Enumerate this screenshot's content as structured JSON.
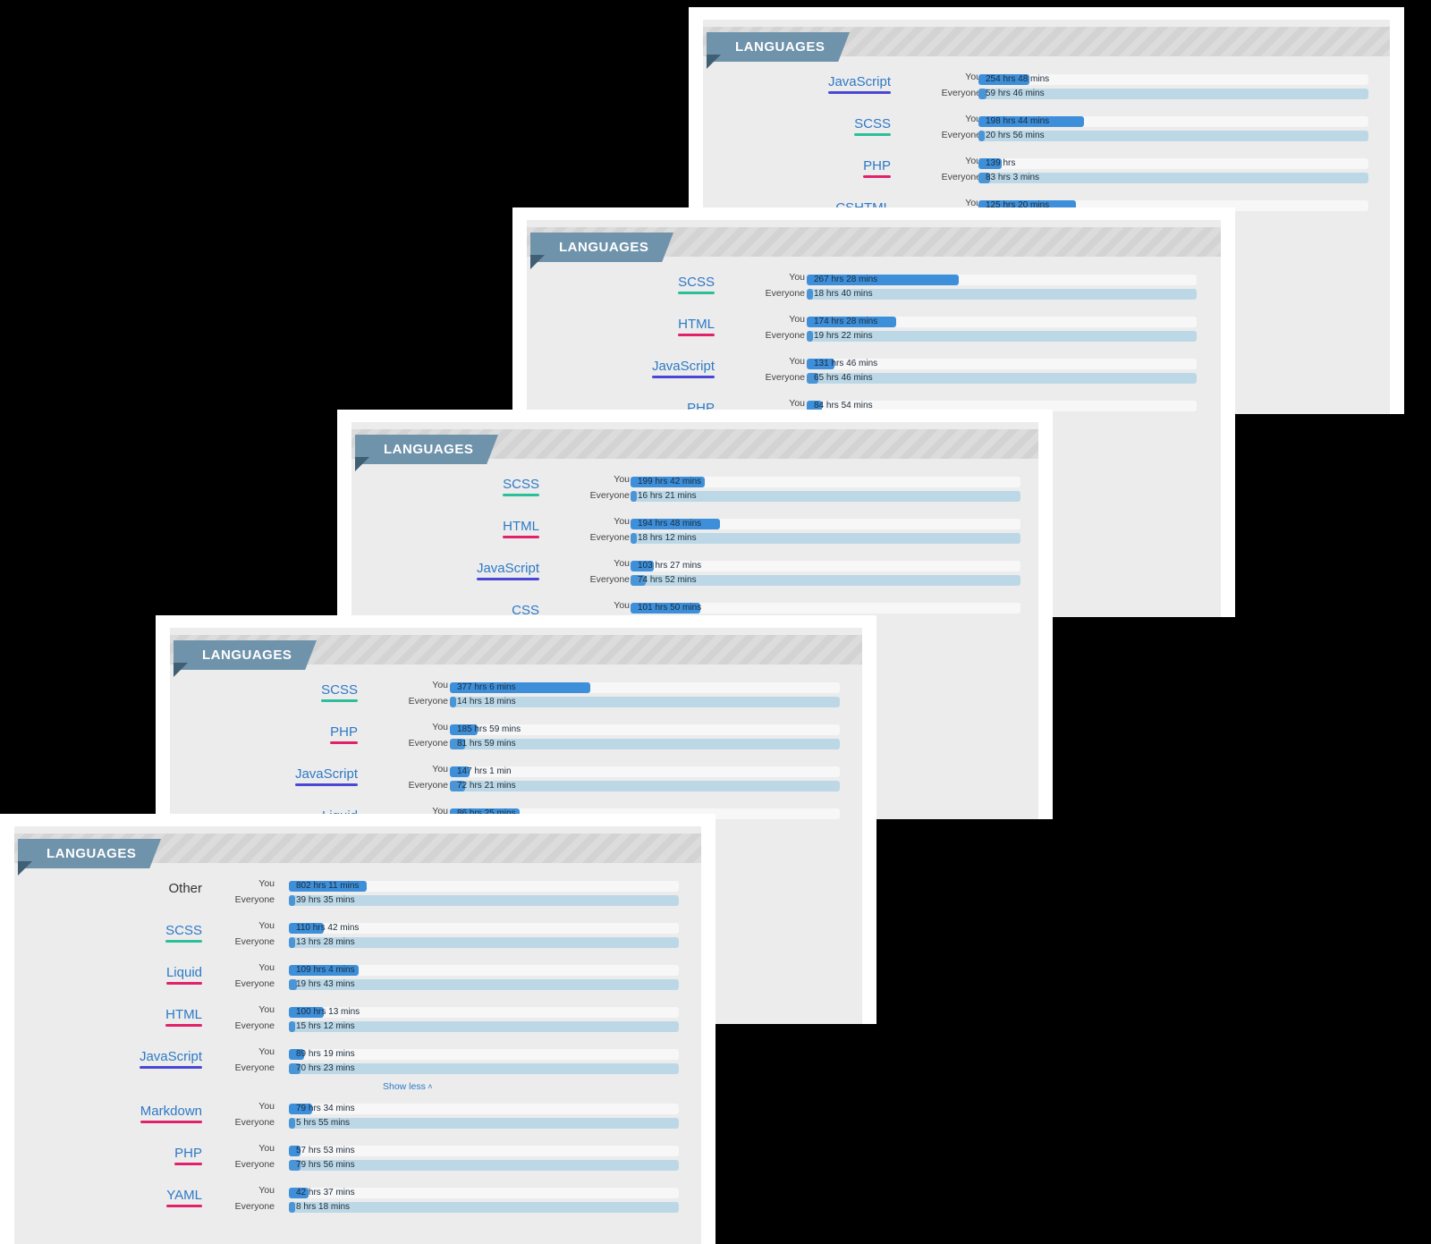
{
  "section_title": "LANGUAGES",
  "show_less": "Show less",
  "labels": {
    "you": "You",
    "everyone": "Everyone"
  },
  "colors": {
    "blue": "#2d79c7",
    "teal": "#2bbf9a",
    "pink": "#e0226b",
    "purple": "#4b47d6"
  },
  "panels": [
    {
      "rows": [
        {
          "lang": "JavaScript",
          "underline": "#4b47d6",
          "you": "254 hrs 48 mins",
          "everyone": "59 hrs 46 mins",
          "you_frac": 0.13,
          "every_frac": 0.02
        },
        {
          "lang": "SCSS",
          "underline": "#2bbf9a",
          "you": "198 hrs 44 mins",
          "everyone": "20 hrs 56 mins",
          "you_frac": 0.27,
          "every_frac": 0.01
        },
        {
          "lang": "PHP",
          "underline": "#e0226b",
          "you": "139 hrs",
          "everyone": "83 hrs 3 mins",
          "you_frac": 0.06,
          "every_frac": 0.03
        },
        {
          "lang": "CSHTML",
          "underline": "",
          "you": "125 hrs 20 mins",
          "everyone": "",
          "you_frac": 0.25,
          "every_frac": 0
        }
      ]
    },
    {
      "rows": [
        {
          "lang": "SCSS",
          "underline": "#2bbf9a",
          "you": "267 hrs 28 mins",
          "everyone": "18 hrs 40 mins",
          "you_frac": 0.39,
          "every_frac": 0.01
        },
        {
          "lang": "HTML",
          "underline": "#e0226b",
          "you": "174 hrs 28 mins",
          "everyone": "19 hrs 22 mins",
          "you_frac": 0.23,
          "every_frac": 0.01
        },
        {
          "lang": "JavaScript",
          "underline": "#4b47d6",
          "you": "131 hrs 46 mins",
          "everyone": "65 hrs 46 mins",
          "you_frac": 0.07,
          "every_frac": 0.03
        },
        {
          "lang": "PHP",
          "underline": "",
          "you": "84 hrs 54 mins",
          "everyone": "",
          "you_frac": 0.04,
          "every_frac": 0
        }
      ]
    },
    {
      "rows": [
        {
          "lang": "SCSS",
          "underline": "#2bbf9a",
          "you": "199 hrs 42 mins",
          "everyone": "16 hrs 21 mins",
          "you_frac": 0.19,
          "every_frac": 0.01
        },
        {
          "lang": "HTML",
          "underline": "#e0226b",
          "you": "194 hrs 48 mins",
          "everyone": "18 hrs 12 mins",
          "you_frac": 0.23,
          "every_frac": 0.01
        },
        {
          "lang": "JavaScript",
          "underline": "#4b47d6",
          "you": "103 hrs 27 mins",
          "everyone": "74 hrs 52 mins",
          "you_frac": 0.06,
          "every_frac": 0.04
        },
        {
          "lang": "CSS",
          "underline": "",
          "you": "101 hrs 50 mins",
          "everyone": "",
          "you_frac": 0.18,
          "every_frac": 0
        }
      ]
    },
    {
      "rows": [
        {
          "lang": "SCSS",
          "underline": "#2bbf9a",
          "you": "377 hrs 6 mins",
          "everyone": "14 hrs 18 mins",
          "you_frac": 0.36,
          "every_frac": 0.01
        },
        {
          "lang": "PHP",
          "underline": "#e0226b",
          "you": "185 hrs 59 mins",
          "everyone": "81 hrs 59 mins",
          "you_frac": 0.07,
          "every_frac": 0.04
        },
        {
          "lang": "JavaScript",
          "underline": "#4b47d6",
          "you": "147 hrs 1 min",
          "everyone": "72 hrs 21 mins",
          "you_frac": 0.05,
          "every_frac": 0.04
        },
        {
          "lang": "Liquid",
          "underline": "",
          "you": "86 hrs 25 mins",
          "everyone": "",
          "you_frac": 0.18,
          "every_frac": 0
        }
      ]
    },
    {
      "rows": [
        {
          "lang": "Other",
          "underline": "",
          "dark": true,
          "you": "802 hrs 11 mins",
          "everyone": "39 hrs 35 mins",
          "you_frac": 0.2,
          "every_frac": 0.01
        },
        {
          "lang": "SCSS",
          "underline": "#2bbf9a",
          "you": "110 hrs 42 mins",
          "everyone": "13 hrs 28 mins",
          "you_frac": 0.09,
          "every_frac": 0.01
        },
        {
          "lang": "Liquid",
          "underline": "#e0226b",
          "you": "109 hrs 4 mins",
          "everyone": "19 hrs 43 mins",
          "you_frac": 0.18,
          "every_frac": 0.02
        },
        {
          "lang": "HTML",
          "underline": "#e0226b",
          "you": "100 hrs 13 mins",
          "everyone": "15 hrs 12 mins",
          "you_frac": 0.09,
          "every_frac": 0.01
        },
        {
          "lang": "JavaScript",
          "underline": "#4b47d6",
          "you": "89 hrs 19 mins",
          "everyone": "70 hrs 23 mins",
          "you_frac": 0.04,
          "every_frac": 0.03
        },
        {
          "showless": true
        },
        {
          "lang": "Markdown",
          "underline": "#e0226b",
          "you": "79 hrs 34 mins",
          "everyone": "5 hrs 55 mins",
          "you_frac": 0.06,
          "every_frac": 0.005
        },
        {
          "lang": "PHP",
          "underline": "#e0226b",
          "you": "57 hrs 53 mins",
          "everyone": "79 hrs 56 mins",
          "you_frac": 0.02,
          "every_frac": 0.03
        },
        {
          "lang": "YAML",
          "underline": "#e0226b",
          "you": "42 hrs 37 mins",
          "everyone": "8 hrs 18 mins",
          "you_frac": 0.05,
          "every_frac": 0.005
        }
      ]
    }
  ]
}
